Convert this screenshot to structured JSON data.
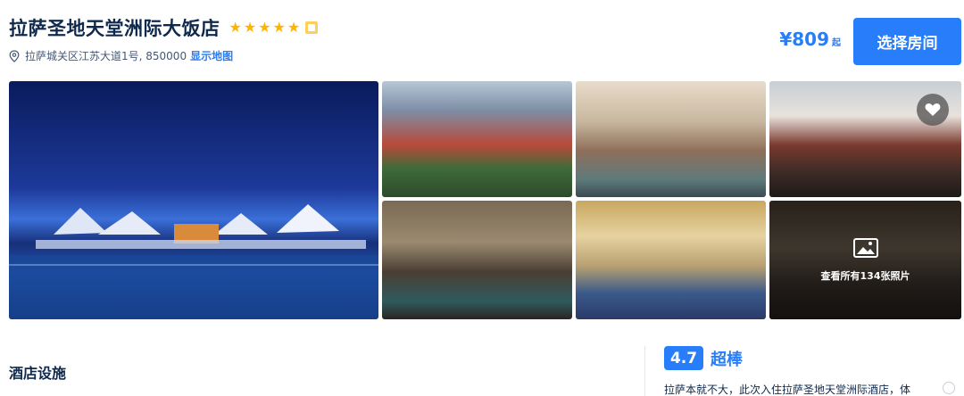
{
  "hotel": {
    "name": "拉萨圣地天堂洲际大饭店",
    "stars": [
      "★",
      "★",
      "★",
      "★",
      "★"
    ],
    "address": "拉萨城关区江苏大道1号, 850000",
    "map_link": "显示地图"
  },
  "pricing": {
    "price": "¥809",
    "suffix": "起",
    "select_button": "选择房间"
  },
  "gallery": {
    "more_photos": "查看所有134张照片"
  },
  "sections": {
    "facilities_title": "酒店设施"
  },
  "rating": {
    "score": "4.7",
    "label": "超棒",
    "review_snippet": "拉萨本就不大，此次入住拉萨圣地天堂洲际酒店，体"
  },
  "colors": {
    "accent": "#287dfa",
    "star": "#ffb400",
    "text": "#0f294d"
  }
}
